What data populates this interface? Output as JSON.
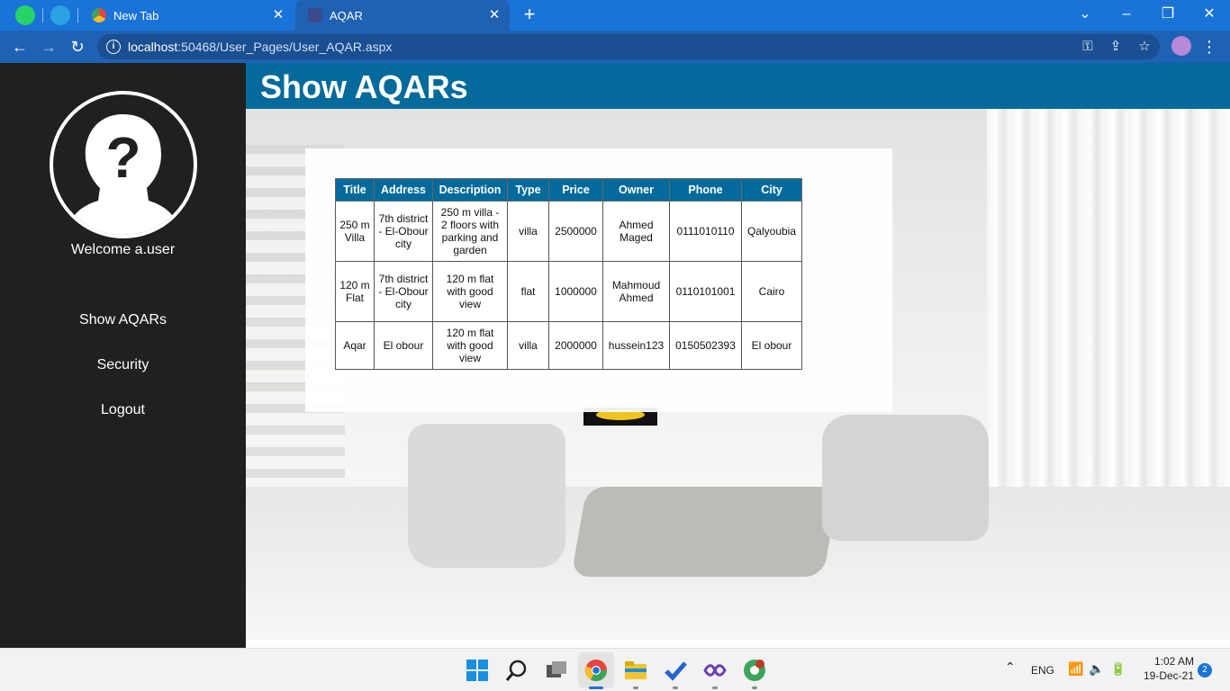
{
  "browser": {
    "tabs": [
      {
        "title": "New Tab"
      },
      {
        "title": "AQAR"
      }
    ],
    "url_host": "localhost",
    "url_rest": ":50468/User_Pages/User_AQAR.aspx"
  },
  "sidebar": {
    "welcome": "Welcome a.user",
    "items": [
      {
        "label": "Show AQARs"
      },
      {
        "label": "Security"
      },
      {
        "label": "Logout"
      }
    ]
  },
  "header": {
    "title": "Show AQARs"
  },
  "table": {
    "columns": [
      "Title",
      "Address",
      "Description",
      "Type",
      "Price",
      "Owner",
      "Phone",
      "City"
    ],
    "rows": [
      {
        "title": "250 m Villa",
        "address": "7th district - El-Obour city",
        "description": "250 m villa - 2 floors with parking and garden",
        "type": "villa",
        "price": "2500000",
        "owner": "Ahmed Maged",
        "phone": "0111010110",
        "city": "Qalyoubia"
      },
      {
        "title": "120 m Flat",
        "address": "7th district - El-Obour city",
        "description": "120 m flat with good view",
        "type": "flat",
        "price": "1000000",
        "owner": "Mahmoud Ahmed",
        "phone": "0110101001",
        "city": "Cairo"
      },
      {
        "title": "Aqar",
        "address": "El obour",
        "description": "120 m flat with good view",
        "type": "villa",
        "price": "2000000",
        "owner": "hussein123",
        "phone": "0150502393",
        "city": "El obour"
      }
    ]
  },
  "taskbar": {
    "language": "ENG",
    "time": "1:02 AM",
    "date": "19-Dec-21",
    "notifications": "2"
  },
  "colors": {
    "header_bg": "#036a9b",
    "sidebar_bg": "#202020",
    "tabbar_bg": "#1a73d9"
  }
}
